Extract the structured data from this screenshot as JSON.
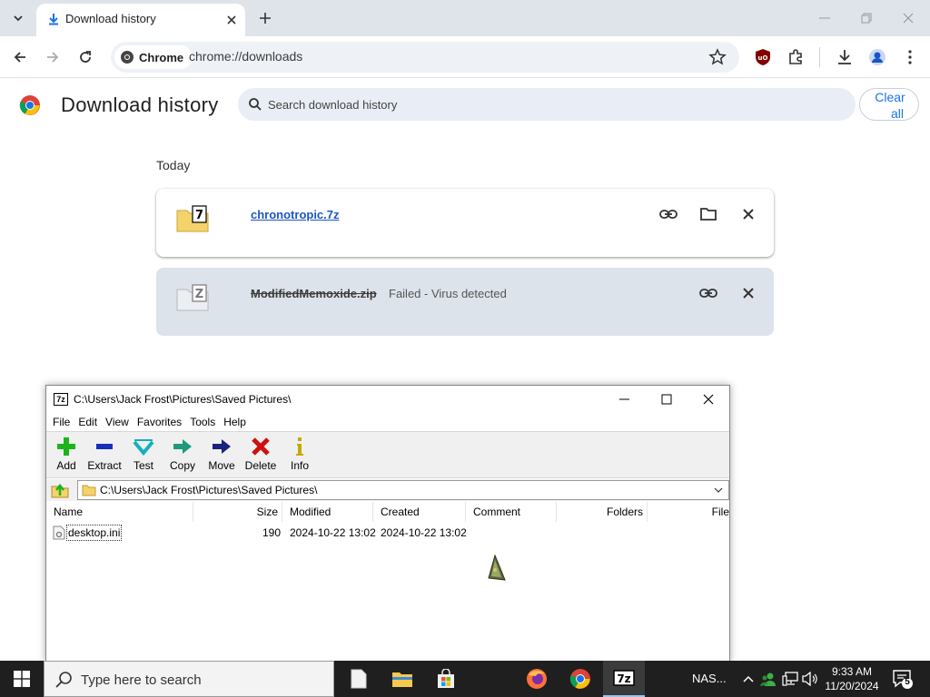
{
  "browser": {
    "tab": {
      "title": "Download history"
    },
    "site_chip": "Chrome",
    "url": "chrome://downloads"
  },
  "downloads_page": {
    "title": "Download history",
    "search_placeholder": "Search download history",
    "clear_all_line1": "Clear",
    "clear_all_line2": "all",
    "section_label": "Today",
    "items": [
      {
        "name": "chronotropic.7z",
        "status": ""
      },
      {
        "name": "ModifiedMemoxide.zip",
        "status": "Failed - Virus detected"
      }
    ]
  },
  "sevenzip": {
    "title": "C:\\Users\\Jack Frost\\Pictures\\Saved Pictures\\",
    "title_icon": "7z",
    "menu": [
      "File",
      "Edit",
      "View",
      "Favorites",
      "Tools",
      "Help"
    ],
    "toolbar": [
      "Add",
      "Extract",
      "Test",
      "Copy",
      "Move",
      "Delete",
      "Info"
    ],
    "path": "C:\\Users\\Jack Frost\\Pictures\\Saved Pictures\\",
    "columns": [
      "Name",
      "Size",
      "Modified",
      "Created",
      "Comment",
      "Folders",
      "File"
    ],
    "rows": [
      {
        "name": "desktop.ini",
        "size": "190",
        "modified": "2024-10-22 13:02",
        "created": "2024-10-22 13:02"
      }
    ]
  },
  "taskbar": {
    "search_placeholder": "Type here to search",
    "nas_label": "NAS...",
    "time": "9:33 AM",
    "date": "11/20/2024",
    "notification_count": "5"
  },
  "colors": {
    "tabstrip": "#dfe3ea",
    "link": "#1a56c4",
    "accent": "#1a73e8",
    "failed_card": "#dde3ea",
    "taskbar": "#1f1f1f"
  }
}
